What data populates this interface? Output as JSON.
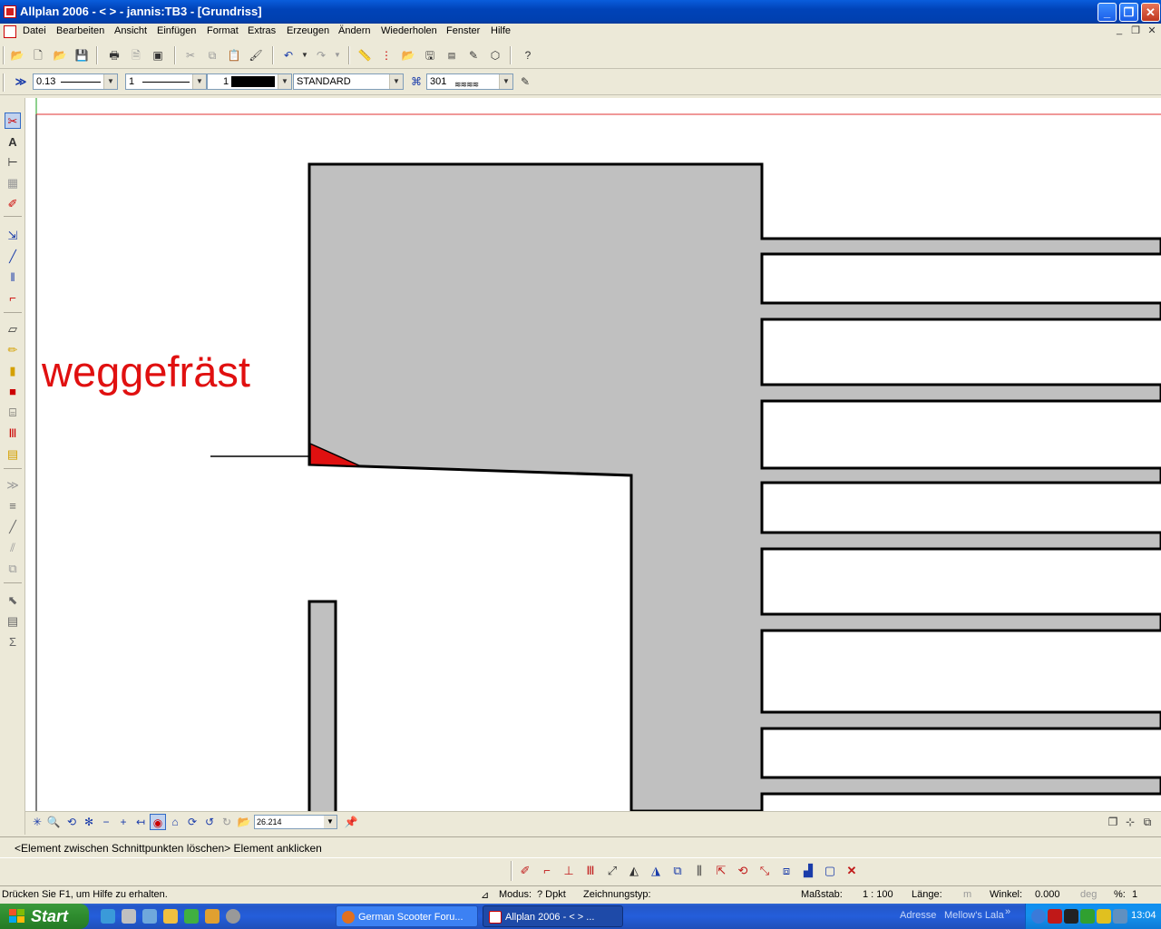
{
  "window": {
    "title": "Allplan 2006 - <       > - jannis:TB3 - [Grundriss]",
    "minimize": "_",
    "restore": "❐",
    "close": "✕"
  },
  "menu": {
    "items": [
      "Datei",
      "Bearbeiten",
      "Ansicht",
      "Einfügen",
      "Format",
      "Extras",
      "Erzeugen",
      "Ändern",
      "Wiederholen",
      "Fenster",
      "Hilfe"
    ],
    "doc_minimize": "_",
    "doc_restore": "❐",
    "doc_close": "✕"
  },
  "format_bar": {
    "expand": "≫",
    "pen_thickness": "0.13",
    "line_type": "1",
    "color": "1",
    "layer": "STANDARD",
    "hatch": "301"
  },
  "drawing": {
    "annotation": "weggefräst",
    "annotation_color": "#e01010",
    "fill_color": "#c0c0c0",
    "highlight_color": "#e01010"
  },
  "canvas_toolbar": {
    "zoom_value": "26.214"
  },
  "prompt": {
    "text": "<Element zwischen Schnittpunkten löschen> Element anklicken"
  },
  "status": {
    "help": "Drücken Sie F1, um Hilfe zu erhalten.",
    "modus_label": "Modus:",
    "modus_value": "? Dpkt",
    "zeichnungstyp_label": "Zeichnungstyp:",
    "massstab_label": "Maßstab:",
    "massstab_value": "1 : 100",
    "laenge_label": "Länge:",
    "laenge_unit": "m",
    "winkel_label": "Winkel:",
    "winkel_value": "0.000",
    "winkel_unit": "deg",
    "percent_label": "%:",
    "percent_value": "1"
  },
  "taskbar": {
    "start": "Start",
    "tasks": [
      {
        "label": "German Scooter Foru...",
        "icon": "firefox-icon"
      },
      {
        "label": "Allplan 2006 - <      > ...",
        "icon": "allplan-icon"
      }
    ],
    "address": "Adresse",
    "music": "Mellow's Lala",
    "time": "13:04"
  }
}
